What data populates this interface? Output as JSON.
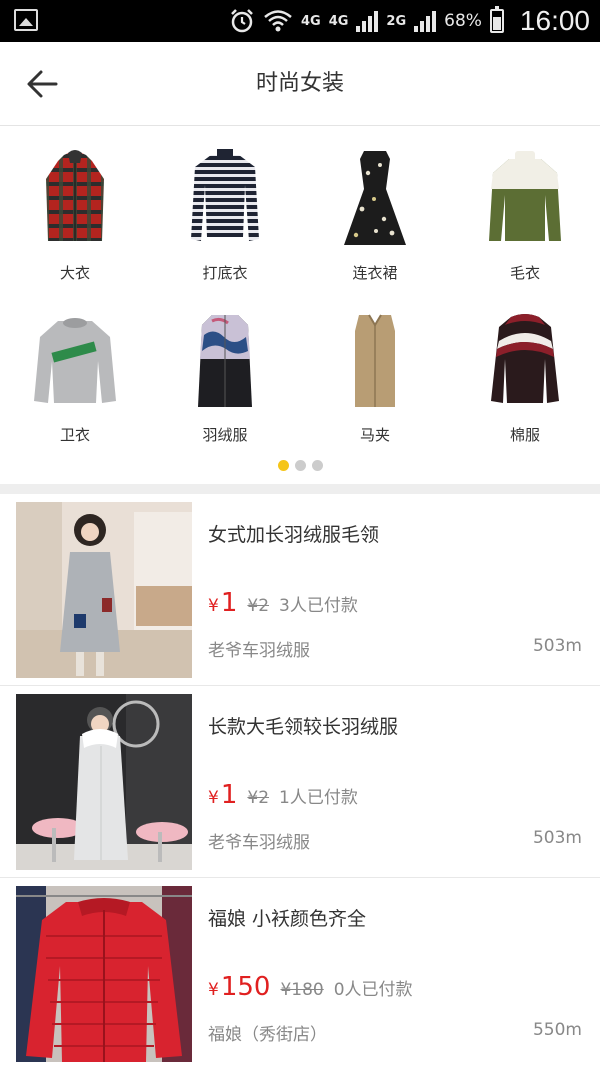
{
  "status_bar": {
    "network_4g": "4G",
    "sim1": "4G",
    "sim2": "2G",
    "battery": "68%",
    "time": "16:00",
    "icons": [
      "image-icon",
      "alarm-icon",
      "wifi-icon",
      "signal-icon",
      "battery-icon"
    ]
  },
  "header": {
    "title": "时尚女装",
    "back_icon": "arrow-left-icon"
  },
  "categories": [
    {
      "label": "大衣",
      "icon": "plaid-coat"
    },
    {
      "label": "打底衣",
      "icon": "striped-sweater"
    },
    {
      "label": "连衣裙",
      "icon": "floral-dress"
    },
    {
      "label": "毛衣",
      "icon": "green-fleece"
    },
    {
      "label": "卫衣",
      "icon": "grey-sweatshirt"
    },
    {
      "label": "羽绒服",
      "icon": "long-down-coat"
    },
    {
      "label": "马夹",
      "icon": "long-vest"
    },
    {
      "label": "棉服",
      "icon": "padded-jacket"
    }
  ],
  "pager": {
    "pages": 3,
    "active": 1
  },
  "products": [
    {
      "name": "女式加长羽绒服毛领",
      "price_symbol": "¥",
      "price": "1",
      "original_price": "¥2",
      "sold": "3人已付款",
      "shop": "老爷车羽绒服",
      "distance": "503m"
    },
    {
      "name": "长款大毛领较长羽绒服",
      "price_symbol": "¥",
      "price": "1",
      "original_price": "¥2",
      "sold": "1人已付款",
      "shop": "老爷车羽绒服",
      "distance": "503m"
    },
    {
      "name": "福娘 小袄颜色齐全",
      "price_symbol": "¥",
      "price": "150",
      "original_price": "¥180",
      "sold": "0人已付款",
      "shop": "福娘（秀街店）",
      "distance": "550m"
    }
  ],
  "colors": {
    "accent": "#f5c518",
    "price": "#e02020"
  }
}
